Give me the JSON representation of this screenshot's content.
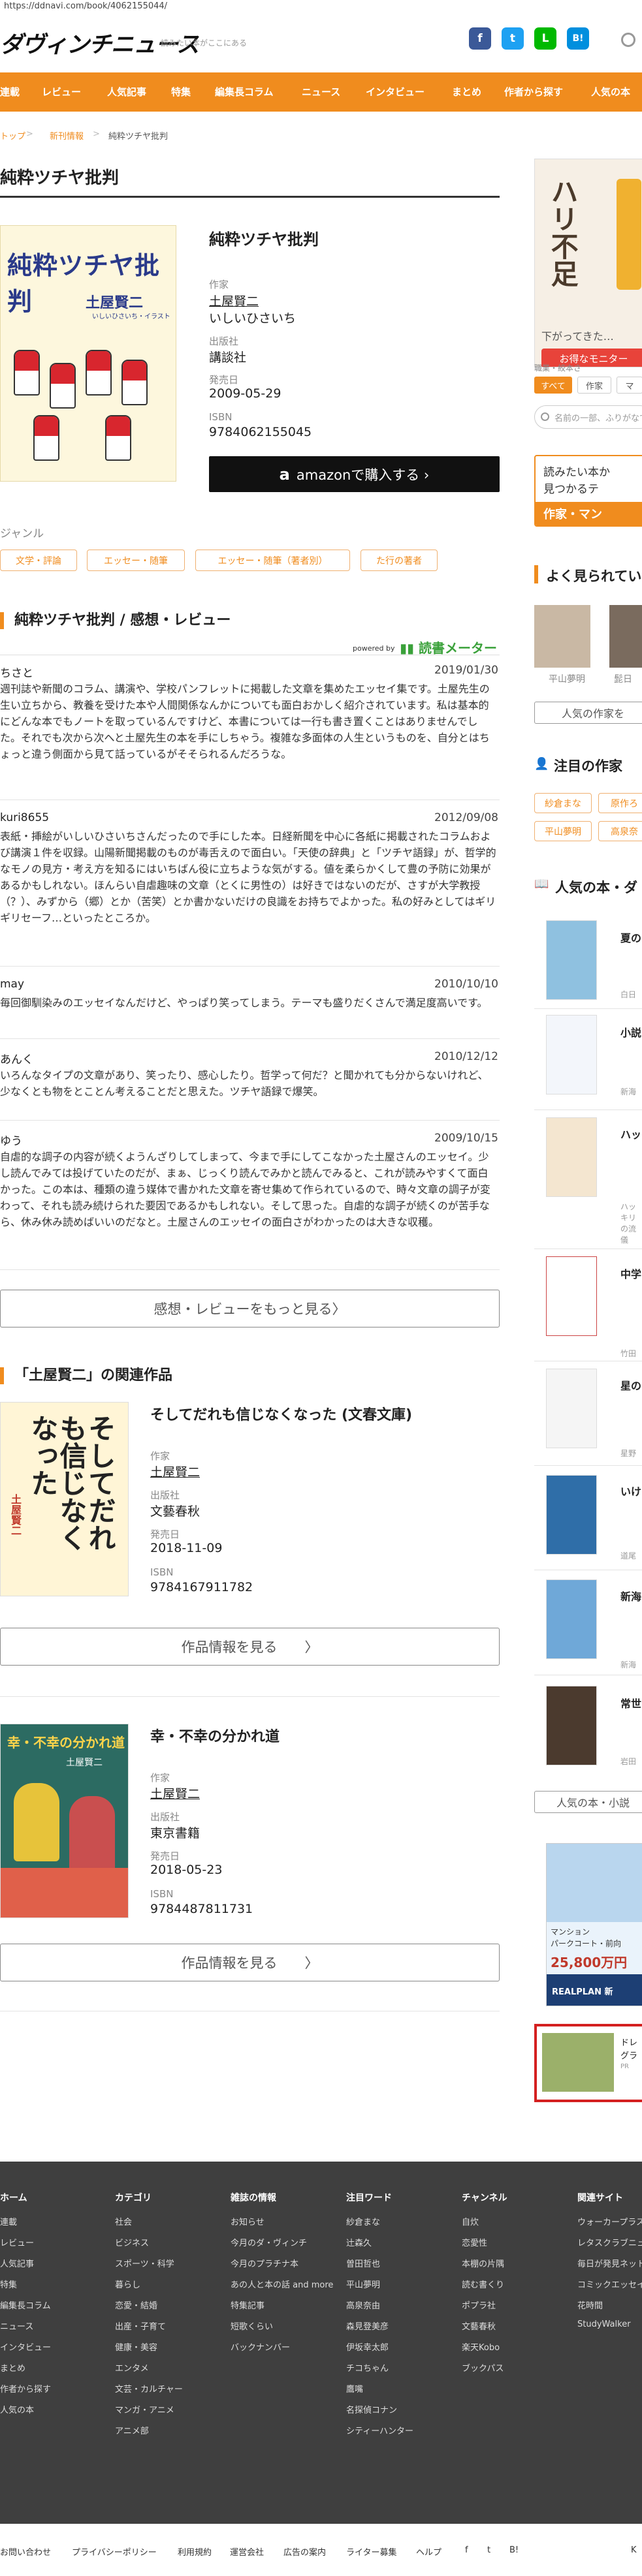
{
  "url": "https://ddnavi.com/book/4062155044/",
  "header": {
    "logo": "ダヴィンチニュース",
    "tagline": "読みたい本がここにある",
    "sns": [
      {
        "name": "facebook",
        "glyph": "f",
        "color": "#3b5998"
      },
      {
        "name": "twitter",
        "glyph": "t",
        "color": "#1da1f2"
      },
      {
        "name": "line",
        "glyph": "L",
        "color": "#00b900"
      },
      {
        "name": "hatena",
        "glyph": "B!",
        "color": "#008fde"
      }
    ]
  },
  "nav": [
    "連載",
    "レビュー",
    "人気記事",
    "特集",
    "編集長コラム",
    "ニュース",
    "インタビュー",
    "まとめ",
    "作者から探す",
    "人気の本"
  ],
  "breadcrumb": {
    "home": "トップ",
    "sep": ">",
    "category": "新刊情報",
    "current": "純粋ツチヤ批判"
  },
  "page_title": "純粋ツチヤ批判",
  "book": {
    "title": "純粋ツチヤ批判",
    "cover_title": "純粋ツチヤ批判",
    "cover_author": "土屋賢二",
    "cover_sub": "いしいひさいち・イラスト",
    "author_label": "作家",
    "author_1": "土屋賢二",
    "author_2": "いしいひさいち",
    "publisher_label": "出版社",
    "publisher": "講談社",
    "date_label": "発売日",
    "date": "2009-05-29",
    "isbn_label": "ISBN",
    "isbn": "9784062155045",
    "amazon_icon": "a",
    "amazon_button": "amazonで購入する ›"
  },
  "genre": {
    "heading": "ジャンル",
    "tags": [
      "文学・評論",
      "エッセー・随筆",
      "エッセー・随筆（著者別）",
      "た行の著者"
    ]
  },
  "reviews": {
    "heading": "純粋ツチヤ批判 / 感想・レビュー",
    "powered_by": "powered by",
    "meter_logo": "読書メーター",
    "items": [
      {
        "user": "ちさと",
        "date": "2019/01/30",
        "text": "週刊誌や新聞のコラム、講演や、学校パンフレットに掲載した文章を集めたエッセイ集です。土屋先生の生い立ちから、教養を受けた本や人間関係なんかについても面白おかしく紹介されています。私は基本的にどんな本でもノートを取っているんですけど、本書については一行も書き置くことはありませんでした。それでも次から次へと土屋先生の本を手にしちゃう。複雑な多面体の人生というものを、自分とはちょっと違う側面から見て話っているがそそられるんだろうな。"
      },
      {
        "user": "kuri8655",
        "date": "2012/09/08",
        "text": "表紙・挿絵がいしいひさいちさんだったので手にした本。日経新聞を中心に各紙に掲載されたコラムおよび講演１件を収録。山陽新聞掲載のものが毒舌えので面白い。「天使の辞典」と「ツチヤ語録」が、哲学的なモノの見方・考え方を知るにはいちばん役に立ちような気がする。値を柔らかくして豊の予防に効果があるかもしれない。ほんらい自虐趣味の文章（とくに男性の）は好きではないのだが、さすが大学教授（？）、みずから（郷）とか（苦笑）とか書かないだけの良識をお持ちでよかった。私の好みとしてはギリギリセーフ…といったところか。"
      },
      {
        "user": "may",
        "date": "2010/10/10",
        "text": "毎回御馴染みのエッセイなんだけど、やっぱり笑ってしまう。テーマも盛りだくさんで満足度高いです。"
      },
      {
        "user": "あんく",
        "date": "2010/12/12",
        "text": "いろんなタイプの文章があり、笑ったり、感心したり。哲学って何だ？と聞かれても分からないけれど、少なくとも物をとことん考えることだと思えた。ツチヤ語録で爆笑。"
      },
      {
        "user": "ゆう",
        "date": "2009/10/15",
        "text": "自虐的な調子の内容が続くようんざりしてしまって、今まで手にしてこなかった土屋さんのエッセイ。少し読んでみては投げていたのだが、まぁ、じっくり読んでみかと読んでみると、これが読みやすくて面白かった。この本は、種類の違う媒体で書かれた文章を寄せ集めて作られているので、時々文章の調子が変わって、それも読み続けられた要因であるかもしれない。そして思った。自虐的な調子が続くのが苦手なら、休み休み読めばいいのだなと。土屋さんのエッセイの面白さがわかったのは大きな収穫。"
      }
    ],
    "more_button": "感想・レビューをもっと見る〉"
  },
  "related": {
    "heading": "「土屋賢二」の関連作品",
    "items": [
      {
        "title": "そしてだれも信じなくなった (文春文庫)",
        "cover_text": "そしてだれも信じなくなった",
        "cover_author": "土屋賢二",
        "author_label": "作家",
        "author": "土屋賢二",
        "publisher_label": "出版社",
        "publisher": "文藝春秋",
        "date_label": "発売日",
        "date": "2018-11-09",
        "isbn_label": "ISBN",
        "isbn": "9784167911782",
        "button": "作品情報を見る　　〉"
      },
      {
        "title": "幸・不幸の分かれ道",
        "cover_text": "幸・不幸の分かれ道",
        "cover_author": "土屋賢二",
        "author_label": "作家",
        "author": "土屋賢二",
        "publisher_label": "出版社",
        "publisher": "東京書籍",
        "date_label": "発売日",
        "date": "2018-05-23",
        "isbn_label": "ISBN",
        "isbn": "9784487811731",
        "button": "作品情報を見る　　〉"
      }
    ]
  },
  "sidebar": {
    "ad1": {
      "headline": "ハリ不足",
      "sub": "下がってきた…",
      "cta": "お得なモニター"
    },
    "filter_label": "職業・絞本さ",
    "tabs": [
      "すべて",
      "作家",
      "マ"
    ],
    "search_placeholder": "名前の一部、ふりがなで",
    "banner_line1": "読みたい本か",
    "banner_line2": "見つかるテ",
    "banner_cta": "作家・マン",
    "popular_authors_heading": "よく見られてい",
    "popular_authors": [
      "平山夢明",
      "髭日"
    ],
    "popular_authors_button": "人気の作家を",
    "notable_heading": "注目の作家",
    "notable_tags": [
      "紗倉まな",
      "原作ろ",
      "平山夢明",
      "高泉奈"
    ],
    "ranking_heading": "人気の本・ダ",
    "ranking": [
      {
        "title": "夏の",
        "sub": "白日"
      },
      {
        "title": "小説",
        "sub": "新海"
      },
      {
        "title": "ハッ",
        "sub": "ハッキリの流儀"
      },
      {
        "title": "中学",
        "sub": "竹田"
      },
      {
        "title": "星の",
        "sub": "星野"
      },
      {
        "title": "いけ",
        "sub": "道尾"
      },
      {
        "title": "新海",
        "sub": "新海"
      },
      {
        "title": "常世",
        "sub": "岩田"
      }
    ],
    "ranking_button": "人気の本・小説",
    "ad2": {
      "label1": "マンション",
      "label2": "パークコート・前向",
      "price": "25,800万円",
      "brand": "REALPLAN 新"
    },
    "ad3": {
      "text": "ドレ",
      "sub": "グラ",
      "pr": "PR"
    }
  },
  "footer": {
    "columns": [
      {
        "heading": "ホーム",
        "items": [
          "連載",
          "レビュー",
          "人気記事",
          "特集",
          "編集長コラム",
          "ニュース",
          "インタビュー",
          "まとめ",
          "作者から探す",
          "人気の本"
        ]
      },
      {
        "heading": "カテゴリ",
        "items": [
          "社会",
          "ビジネス",
          "スポーツ・科学",
          "暮らし",
          "恋愛・結婚",
          "出産・子育て",
          "健康・美容",
          "エンタメ",
          "文芸・カルチャー",
          "マンガ・アニメ",
          "アニメ部"
        ]
      },
      {
        "heading": "雑誌の情報",
        "items": [
          "お知らせ",
          "今月のダ・ヴィンチ",
          "今月のプラチナ本",
          "あの人と本の話 and more",
          "特集記事",
          "短歌くらい",
          "バックナンバー"
        ]
      },
      {
        "heading": "注目ワード",
        "items": [
          "紗倉まな",
          "辻森久",
          "曽田哲也",
          "平山夢明",
          "高泉奈由",
          "森見登美彦",
          "伊坂幸太郎",
          "チコちゃん",
          "鷹嘴",
          "名探偵コナン",
          "シティーハンター"
        ]
      },
      {
        "heading": "チャンネル",
        "items": [
          "自炊",
          "恋愛性",
          "本棚の片隅",
          "読む書くり",
          "ポプラ社",
          "文藝春秋",
          "楽天Kobo",
          "ブックパス"
        ]
      },
      {
        "heading": "関連サイト",
        "items": [
          "ウォーカープラス",
          "レタスクラブニュース",
          "毎日が発見ネット",
          "コミックエッセイ劇場",
          "花時間",
          "StudyWalker"
        ]
      }
    ],
    "bottom_links": [
      "お問い合わせ",
      "プライバシーポリシー",
      "利用規約",
      "運営会社",
      "広告の案内",
      "ライター募集",
      "ヘルプ"
    ],
    "bottom_icons": [
      "f",
      "t",
      "B!",
      "K"
    ]
  }
}
